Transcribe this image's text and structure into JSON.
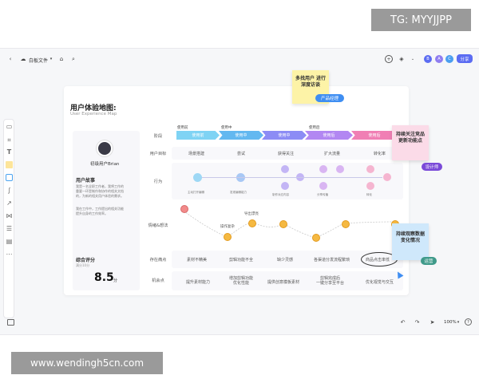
{
  "watermark_top": "TG: MYYJJPP",
  "watermark_bottom": "www.wendingh5cn.com",
  "topbar": {
    "file_name": "白板文件",
    "share_label": "分享"
  },
  "board": {
    "title": "用户体验地图:",
    "subtitle": "User Experience Map",
    "user_name": "初级用户Brian",
    "story_title": "用户故事",
    "story_text": [
      "我是一名全职工作者，我将工作的",
      "重要一环是制作和协作的相关文档",
      "的，为新的相关用户体验的需求。",
      "我在工作中，工作提出的相关功能",
      "提升自身的工作效率。"
    ],
    "score_label": "综合评分",
    "score_sub": "满分10分",
    "score_value": "8.5",
    "score_unit": "分",
    "stage_label": "阶段",
    "stages": [
      "使用前",
      "使用中",
      "使用中",
      "使用后",
      "使用后"
    ],
    "stage_heads": [
      "使用前",
      "使用中",
      "",
      "使用后",
      ""
    ],
    "rows": {
      "goal": "用户目标",
      "action": "行为",
      "emotion": "情绪&想法",
      "pain": "存在痛点",
      "opportunity": "机会点"
    },
    "goals": [
      "场景搭建",
      "尝试",
      "获得关注",
      "扩大流量",
      "转化率"
    ],
    "actions": [
      "主动打开编辑",
      "发现编辑能力",
      "制作对应内容",
      "分享传播",
      "转化"
    ],
    "emotion_labels": [
      "操作复杂",
      "导出漂亮"
    ],
    "pains": [
      "素材不精美",
      "剪辑功能不全",
      "缺少灵感",
      "各渠道分发流程繁琐",
      "商品点击率低"
    ],
    "opps": [
      "提升素材能力",
      "增加剪辑功能\n优化性能",
      "提供创意模板素材",
      "剪辑完成后\n一键分享至平台",
      "优化视觉与交互"
    ]
  },
  "stickies": [
    {
      "text": "多找用户 进行深度访谈",
      "tag": "产品经理"
    },
    {
      "text": "持续关注竞品更新功能点",
      "tag": "设计师"
    },
    {
      "text": "持续观察数据变化情况",
      "tag": "运营"
    }
  ],
  "bottom": {
    "zoom": "100%"
  },
  "colors": {
    "accent": "#5b6cf2",
    "sticky_yellow": "#fdf3a7",
    "sticky_pink": "#fbdbe8",
    "sticky_blue": "#cfe8fb",
    "stage1": "#7fd3f4",
    "stage2": "#63b8f0",
    "stage3": "#8c8cf5",
    "stage4": "#b287f2",
    "stage5": "#f07fb4"
  }
}
